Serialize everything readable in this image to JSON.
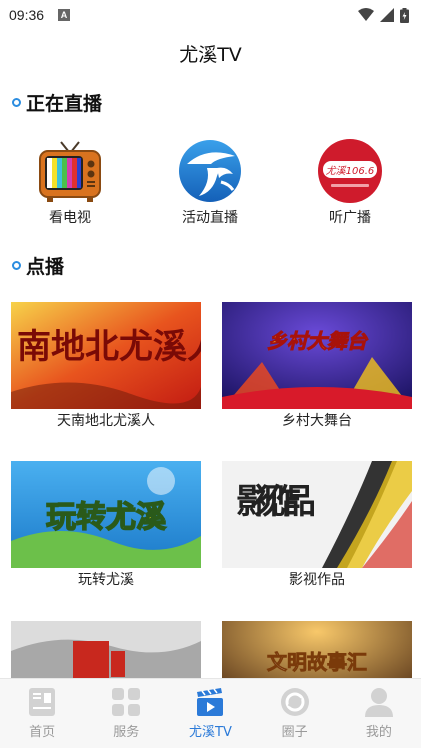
{
  "status": {
    "time": "09:36",
    "notification_letter": "A"
  },
  "header": {
    "title": "尤溪TV"
  },
  "live": {
    "section_title": "正在直播",
    "items": [
      {
        "label": "看电视",
        "icon": "tv-icon"
      },
      {
        "label": "活动直播",
        "icon": "activity-live-icon"
      },
      {
        "label": "听广播",
        "icon": "radio-icon",
        "badge_text": "尤溪106.6"
      }
    ]
  },
  "vod": {
    "section_title": "点播",
    "items": [
      {
        "label": "天南地北尤溪人",
        "thumb_text": "南地北尤溪人"
      },
      {
        "label": "乡村大舞台",
        "thumb_text": "乡村大舞台"
      },
      {
        "label": "玩转尤溪",
        "thumb_text": "玩转尤溪"
      },
      {
        "label": "影视作品",
        "thumb_text": "影视作品"
      },
      {
        "label": "",
        "thumb_text": ""
      },
      {
        "label": "",
        "thumb_text": "文明故事汇"
      }
    ]
  },
  "tabbar": {
    "tabs": [
      {
        "label": "首页",
        "icon": "home-news-icon",
        "active": false
      },
      {
        "label": "服务",
        "icon": "services-grid-icon",
        "active": false
      },
      {
        "label": "尤溪TV",
        "icon": "tv-clapper-icon",
        "active": true
      },
      {
        "label": "圈子",
        "icon": "circle-icon",
        "active": false
      },
      {
        "label": "我的",
        "icon": "profile-icon",
        "active": false
      }
    ]
  },
  "colors": {
    "accent": "#2b7ad8",
    "inactive": "#9a9a9a",
    "tabbar_bg": "#f7f7f7"
  }
}
